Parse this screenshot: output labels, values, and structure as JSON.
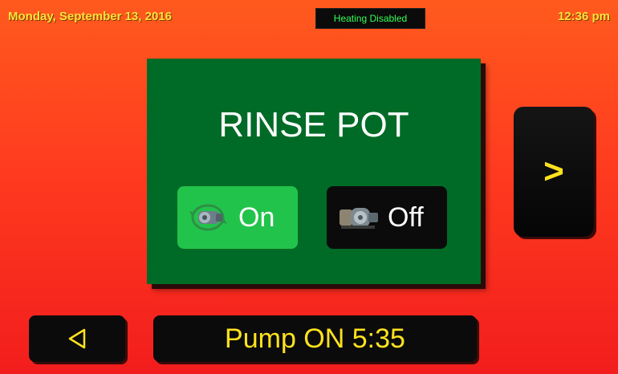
{
  "header": {
    "date": "Monday, September 13, 2016",
    "time": "12:36 pm",
    "heating_status": "Heating Disabled"
  },
  "panel": {
    "title": "RINSE POT",
    "on_label": "On",
    "off_label": "Off",
    "on_icon": "pump-running-icon",
    "off_icon": "pump-icon"
  },
  "navigation": {
    "next_label": ">",
    "back_icon": "triangle-left-icon"
  },
  "status": {
    "message": "Pump ON 5:35"
  },
  "colors": {
    "background_top": "#ff5a1e",
    "background_bottom": "#f21d1d",
    "panel": "#006b26",
    "on_active": "#22c34a",
    "accent_yellow": "#ffe21e",
    "heating_badge_text": "#33ff55"
  }
}
